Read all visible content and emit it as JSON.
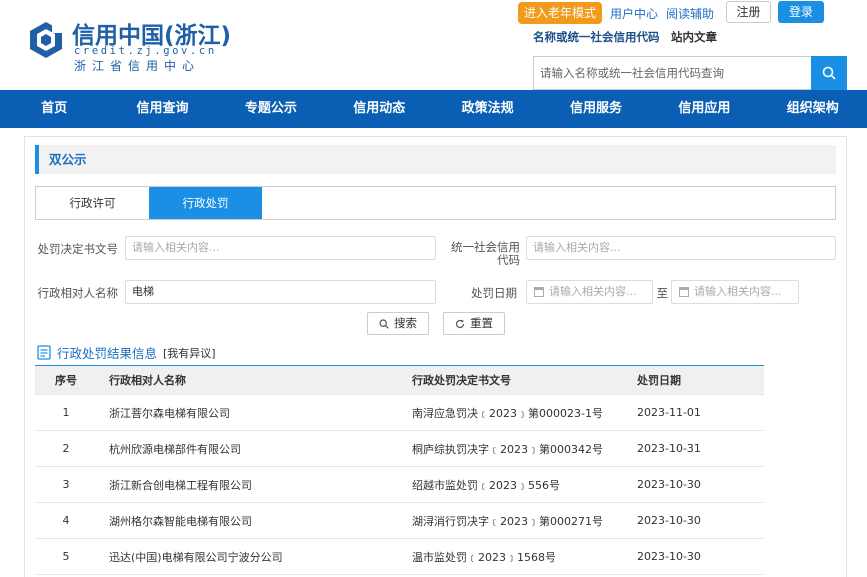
{
  "header": {
    "logo_title": "信用中国(浙江)",
    "logo_domain": "credit.zj.gov.cn",
    "logo_org": "浙江省信用中心",
    "elder_mode": "进入老年模式",
    "user_center": "用户中心",
    "reading_aid": "阅读辅助",
    "register": "注册",
    "login": "登录",
    "search_type_active": "名称或统一社会信用代码",
    "search_type_other": "站内文章",
    "search_placeholder": "请输入名称或统一社会信用代码查询"
  },
  "nav": {
    "items": [
      "首页",
      "信用查询",
      "专题公示",
      "信用动态",
      "政策法规",
      "信用服务",
      "信用应用",
      "组织架构"
    ]
  },
  "section": {
    "title": "双公示",
    "tabs": [
      "行政许可",
      "行政处罚"
    ],
    "active_tab": "行政处罚"
  },
  "filters": {
    "decision_no_label": "处罚决定书文号",
    "decision_no_placeholder": "请输入相关内容...",
    "credit_code_label": "统一社会信用代码",
    "credit_code_placeholder": "请输入相关内容...",
    "party_label": "行政相对人名称",
    "party_value": "电梯",
    "date_label": "处罚日期",
    "date_start_placeholder": "请输入相关内容...",
    "date_sep": "至",
    "date_end_placeholder": "请输入相关内容...",
    "search_btn": "搜索",
    "reset_btn": "重置"
  },
  "results": {
    "title": "行政处罚结果信息",
    "objection": "[我有异议]",
    "columns": [
      "序号",
      "行政相对人名称",
      "行政处罚决定书文号",
      "处罚日期"
    ],
    "rows": [
      {
        "no": "1",
        "name": "浙江菩尔森电梯有限公司",
        "doc": "南浔应急罚决﹝2023﹞第000023-1号",
        "date": "2023-11-01"
      },
      {
        "no": "2",
        "name": "杭州欣源电梯部件有限公司",
        "doc": "桐庐综执罚决字﹝2023﹞第000342号",
        "date": "2023-10-31"
      },
      {
        "no": "3",
        "name": "浙江新合创电梯工程有限公司",
        "doc": "绍越市监处罚﹝2023﹞556号",
        "date": "2023-10-30"
      },
      {
        "no": "4",
        "name": "湖州格尔森智能电梯有限公司",
        "doc": "湖浔消行罚决字﹝2023﹞第000271号",
        "date": "2023-10-30"
      },
      {
        "no": "5",
        "name": "迅达(中国)电梯有限公司宁波分公司",
        "doc": "温市监处罚﹝2023﹞1568号",
        "date": "2023-10-30"
      }
    ]
  },
  "colors": {
    "brand_blue": "#0a5fb4",
    "accent_blue": "#1a8fe3",
    "orange": "#f29a1b"
  }
}
